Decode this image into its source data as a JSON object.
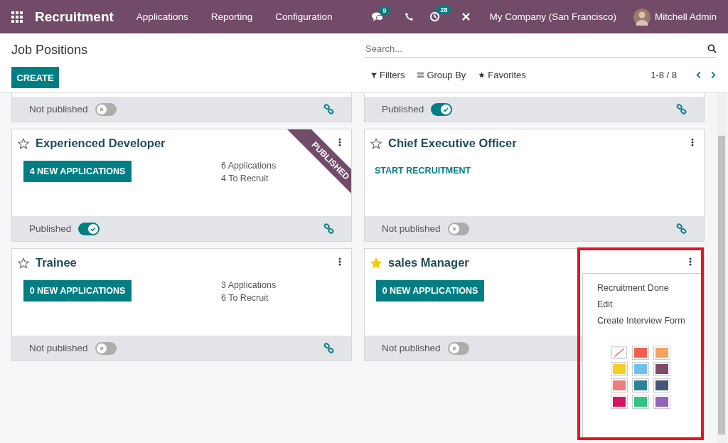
{
  "navbar": {
    "app_name": "Recruitment",
    "menu": [
      "Applications",
      "Reporting",
      "Configuration"
    ],
    "messages_badge": "9",
    "activities_badge": "28",
    "company": "My Company (San Francisco)",
    "user": "Mitchell Admin"
  },
  "control_panel": {
    "title": "Job Positions",
    "create_button": "CREATE",
    "search": {
      "placeholder": "Search..."
    },
    "filters": "Filters",
    "group_by": "Group By",
    "favorites": "Favorites",
    "pager": "1-8 / 8"
  },
  "top_footers": [
    {
      "status": "Not published",
      "published": false,
      "link": true
    },
    {
      "status": "Published",
      "published": true,
      "link": true
    }
  ],
  "cards": [
    {
      "title": "Experienced Developer",
      "starred": false,
      "kind": "button",
      "action": "4 NEW APPLICATIONS",
      "stats": [
        "6 Applications",
        "4 To Recruit"
      ],
      "ribbon": "PUBLISHED",
      "status": "Published",
      "published": true,
      "link": true
    },
    {
      "title": "Chief Executive Officer",
      "starred": false,
      "kind": "link",
      "action": "START RECRUITMENT",
      "status": "Not published",
      "published": false,
      "link": true
    },
    {
      "title": "Trainee",
      "starred": false,
      "kind": "button",
      "action": "0 NEW APPLICATIONS",
      "stats": [
        "3 Applications",
        "6 To Recruit"
      ],
      "status": "Not published",
      "published": false,
      "link": true
    },
    {
      "title": "sales Manager",
      "starred": true,
      "kind": "button",
      "action": "0 NEW APPLICATIONS",
      "status": "Not published",
      "published": false
    }
  ],
  "dropdown": {
    "items": [
      "Recruitment Done",
      "Edit",
      "Create Interview Form"
    ],
    "swatches": [
      {
        "kind": "none"
      },
      {
        "kind": "color",
        "color": "#f06050"
      },
      {
        "kind": "color",
        "color": "#f4a460"
      },
      {
        "kind": "color",
        "color": "#f7cd1f"
      },
      {
        "kind": "color",
        "color": "#6cc1ed"
      },
      {
        "kind": "color",
        "color": "#814968"
      },
      {
        "kind": "color",
        "color": "#eb7e7f"
      },
      {
        "kind": "color",
        "color": "#2c8397"
      },
      {
        "kind": "color",
        "color": "#475577"
      },
      {
        "kind": "color",
        "color": "#d6145f"
      },
      {
        "kind": "color",
        "color": "#30c381"
      },
      {
        "kind": "color",
        "color": "#9365b8"
      }
    ]
  }
}
